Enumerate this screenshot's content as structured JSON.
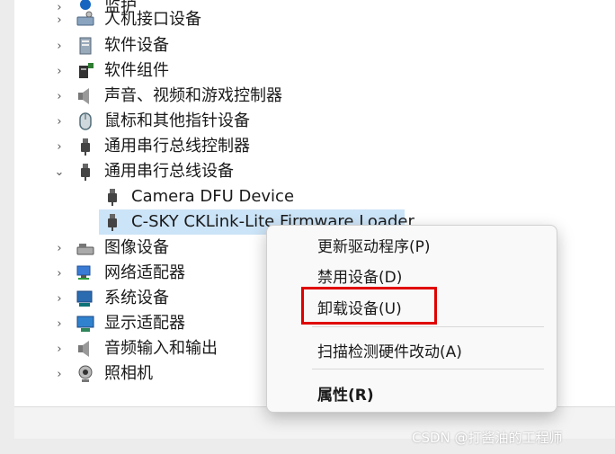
{
  "tree": {
    "items": [
      {
        "label": "监护",
        "expanded": false,
        "icon": "security-device-icon"
      },
      {
        "label": "人机接口设备",
        "expanded": false,
        "icon": "hid-icon"
      },
      {
        "label": "软件设备",
        "expanded": false,
        "icon": "software-device-icon"
      },
      {
        "label": "软件组件",
        "expanded": false,
        "icon": "software-component-icon"
      },
      {
        "label": "声音、视频和游戏控制器",
        "expanded": false,
        "icon": "speaker-icon"
      },
      {
        "label": "鼠标和其他指针设备",
        "expanded": false,
        "icon": "mouse-icon"
      },
      {
        "label": "通用串行总线控制器",
        "expanded": false,
        "icon": "usb-icon"
      },
      {
        "label": "通用串行总线设备",
        "expanded": true,
        "icon": "usb-icon"
      },
      {
        "label": "Camera DFU Device",
        "child": true,
        "icon": "usb-icon"
      },
      {
        "label": "C-SKY CKLink-Lite Firmware Loader",
        "child": true,
        "selected": true,
        "icon": "usb-icon"
      },
      {
        "label": "图像设备",
        "expanded": false,
        "icon": "scanner-icon"
      },
      {
        "label": "网络适配器",
        "expanded": false,
        "icon": "network-adapter-icon"
      },
      {
        "label": "系统设备",
        "expanded": false,
        "icon": "system-device-icon"
      },
      {
        "label": "显示适配器",
        "expanded": false,
        "icon": "display-adapter-icon"
      },
      {
        "label": "音频输入和输出",
        "expanded": false,
        "icon": "speaker-icon"
      },
      {
        "label": "照相机",
        "expanded": false,
        "icon": "webcam-icon"
      }
    ]
  },
  "context_menu": {
    "update_driver": "更新驱动程序(P)",
    "disable_device": "禁用设备(D)",
    "uninstall_device": "卸载设备(U)",
    "scan_hardware": "扫描检测硬件改动(A)",
    "properties": "属性(R)"
  },
  "watermark": "CSDN @打酱油的工程师",
  "colors": {
    "highlight": "#e00000",
    "selection": "#cce4f7"
  }
}
